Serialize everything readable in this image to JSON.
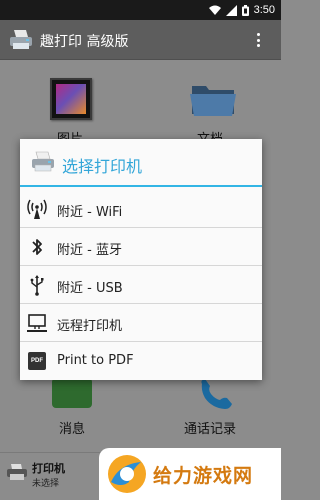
{
  "status_bar": {
    "time": "3:50"
  },
  "app_bar": {
    "title": "趣打印 高级版"
  },
  "background_tiles": {
    "photos_label": "图片",
    "docs_label": "文档",
    "messages_label": "消息",
    "calls_label": "通话记录"
  },
  "bottom_bar": {
    "title": "打印机",
    "subtitle": "未选择"
  },
  "dialog": {
    "title": "选择打印机",
    "items": [
      {
        "label": "附近 - WiFi",
        "icon": "wifi-antenna-icon"
      },
      {
        "label": "附近 - 蓝牙",
        "icon": "bluetooth-icon"
      },
      {
        "label": "附近 - USB",
        "icon": "usb-icon"
      },
      {
        "label": "远程打印机",
        "icon": "computer-icon"
      },
      {
        "label": "Print to PDF",
        "icon": "pdf-icon",
        "badge": "PDF"
      }
    ]
  },
  "watermark": {
    "text": "给力游戏网"
  },
  "colors": {
    "accent": "#33b5e5",
    "dim_background": "#8c8c8c",
    "app_bar": "#5d5d5d",
    "status_bar": "#1a1a1a",
    "watermark_text": "#d47a10"
  }
}
